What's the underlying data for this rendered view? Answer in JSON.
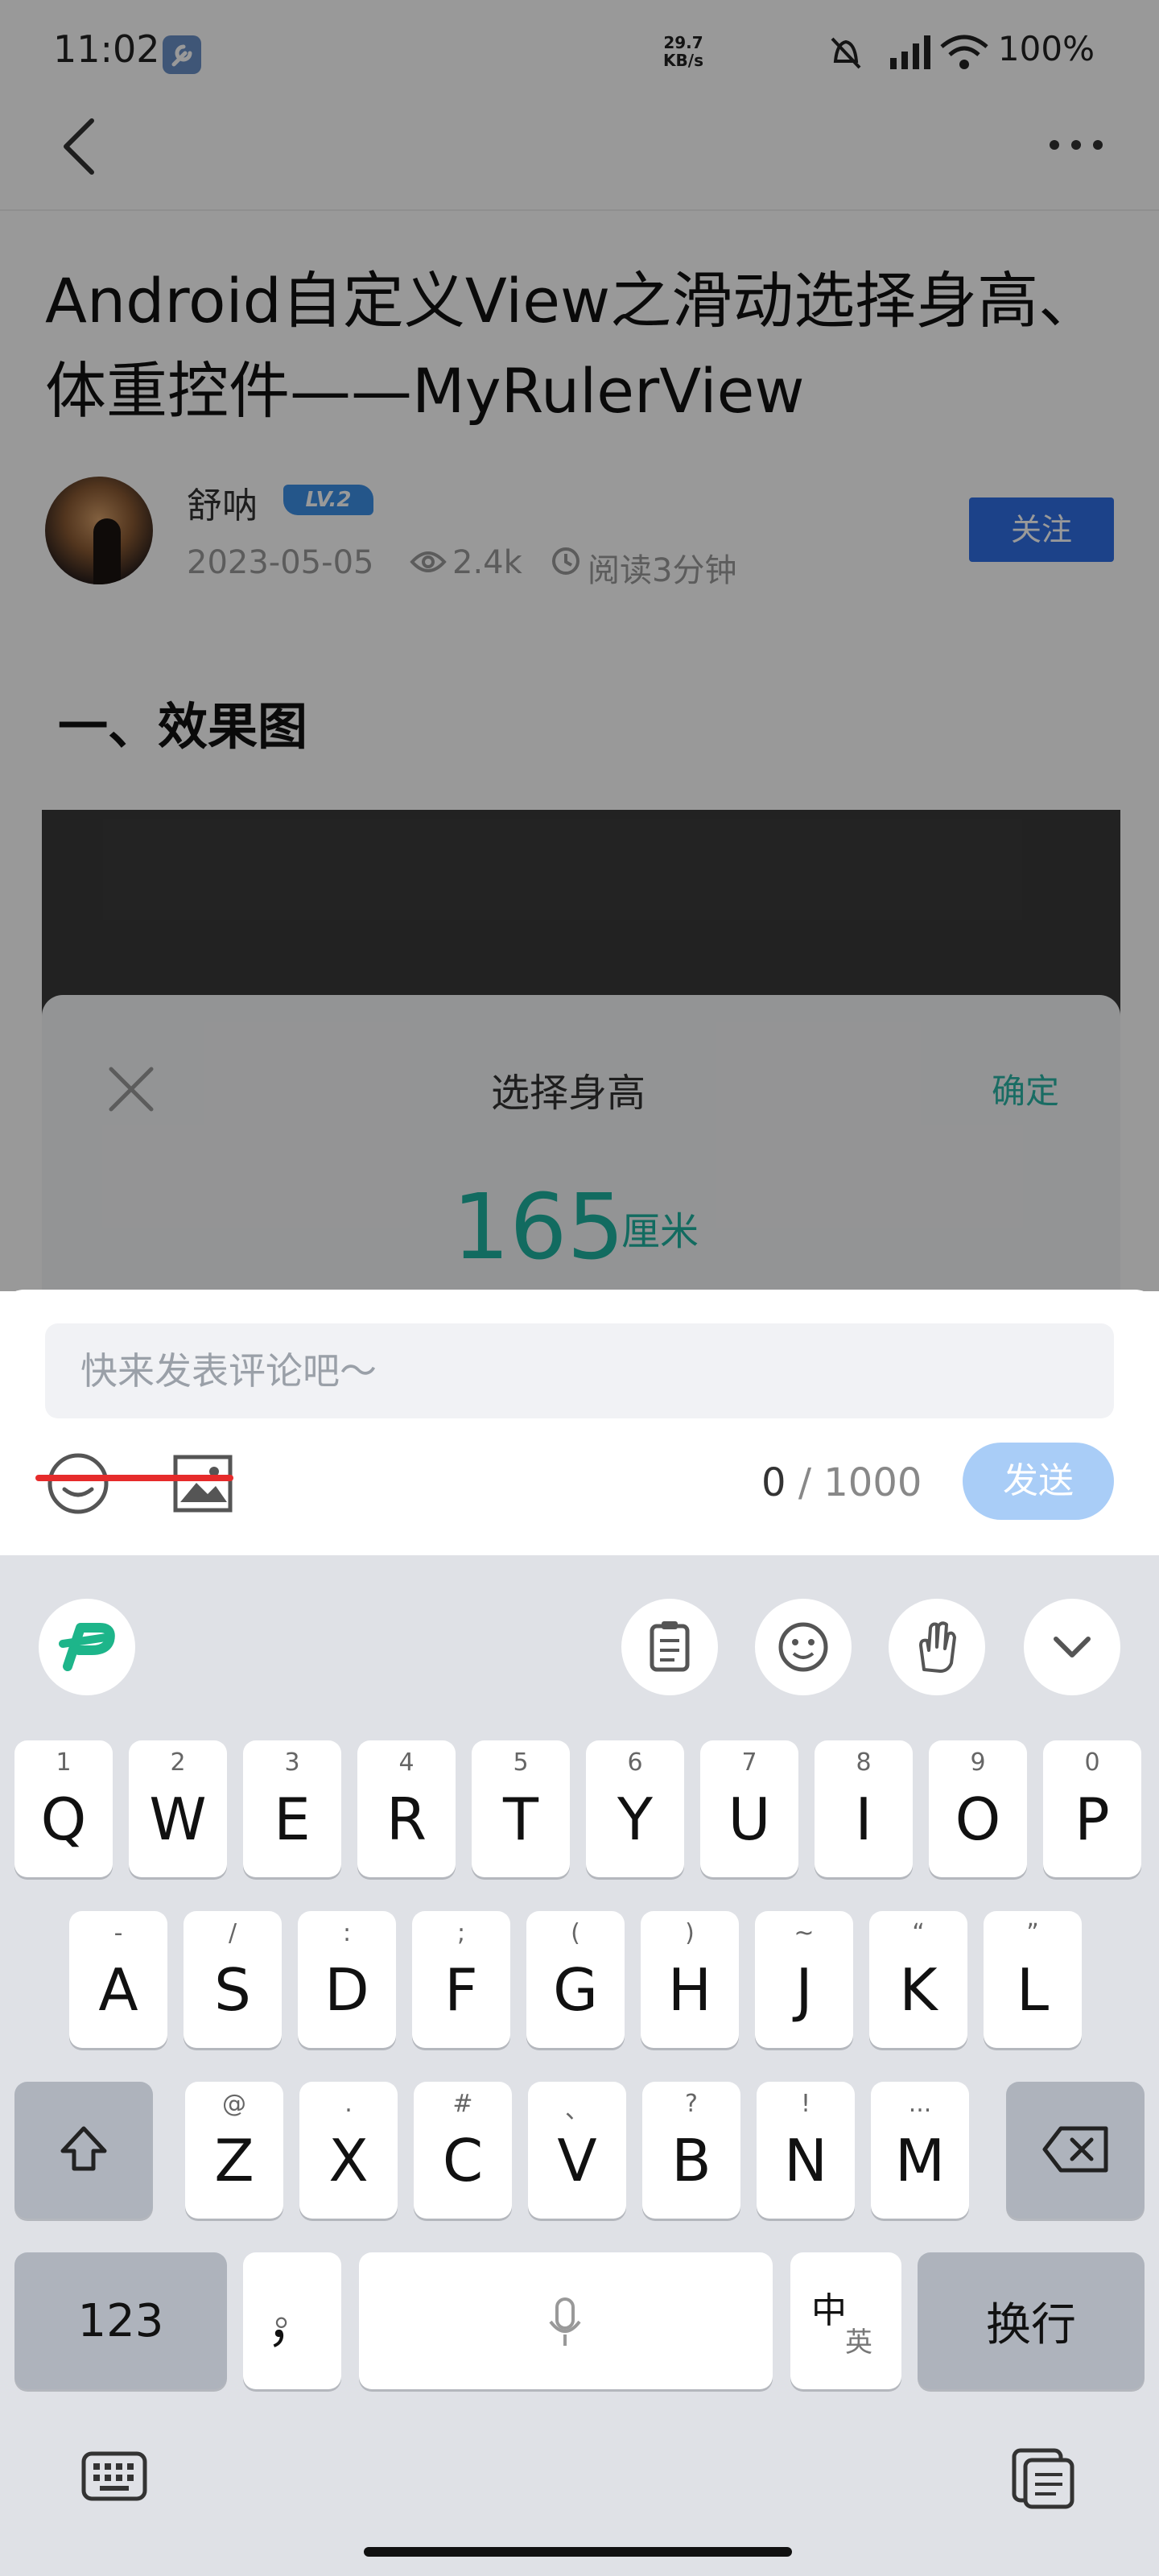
{
  "status_bar": {
    "time": "11:02",
    "speed_value": "29.7",
    "speed_unit": "KB/s",
    "battery": "100%"
  },
  "article": {
    "title": "Android自定义View之滑动选择身高、体重控件——MyRulerView",
    "author": "舒呐",
    "level": "LV.2",
    "date": "2023-05-05",
    "views": "2.4k",
    "read_time": "阅读3分钟",
    "follow_label": "关注",
    "section_heading": "一、效果图"
  },
  "picker": {
    "title": "选择身高",
    "confirm_label": "确定",
    "value": "165",
    "unit": "厘米"
  },
  "comment": {
    "placeholder": "快来发表评论吧～",
    "count": "0",
    "max": "/ 1000",
    "send_label": "发送"
  },
  "keyboard": {
    "row1": [
      {
        "main": "Q",
        "sub": "1"
      },
      {
        "main": "W",
        "sub": "2"
      },
      {
        "main": "E",
        "sub": "3"
      },
      {
        "main": "R",
        "sub": "4"
      },
      {
        "main": "T",
        "sub": "5"
      },
      {
        "main": "Y",
        "sub": "6"
      },
      {
        "main": "U",
        "sub": "7"
      },
      {
        "main": "I",
        "sub": "8"
      },
      {
        "main": "O",
        "sub": "9"
      },
      {
        "main": "P",
        "sub": "0"
      }
    ],
    "row2": [
      {
        "main": "A",
        "sub": "-"
      },
      {
        "main": "S",
        "sub": "/"
      },
      {
        "main": "D",
        "sub": ":"
      },
      {
        "main": "F",
        "sub": ";"
      },
      {
        "main": "G",
        "sub": "("
      },
      {
        "main": "H",
        "sub": ")"
      },
      {
        "main": "J",
        "sub": "~"
      },
      {
        "main": "K",
        "sub": "“"
      },
      {
        "main": "L",
        "sub": "”"
      }
    ],
    "row3": [
      {
        "main": "Z",
        "sub": "@"
      },
      {
        "main": "X",
        "sub": "."
      },
      {
        "main": "C",
        "sub": "#"
      },
      {
        "main": "V",
        "sub": "、"
      },
      {
        "main": "B",
        "sub": "?"
      },
      {
        "main": "N",
        "sub": "!"
      },
      {
        "main": "M",
        "sub": "..."
      }
    ],
    "numbers_label": "123",
    "comma_key": "，",
    "comma_sub": "。",
    "lang_main": "中",
    "lang_sub": "英",
    "enter_label": "换行"
  },
  "colors": {
    "accent_teal": "#1fb2a0",
    "follow_blue": "#2f6fe4",
    "send_disabled": "#a9cdf7",
    "keyboard_bg": "#dfe1e6"
  },
  "icons": [
    "wrench-icon",
    "back-icon",
    "more-icon",
    "eye-icon",
    "clock-icon",
    "close-icon",
    "emoji-icon",
    "image-icon",
    "clipboard-icon",
    "sticker-icon",
    "gesture-icon",
    "chevron-down-icon",
    "shift-icon",
    "backspace-icon",
    "mic-icon",
    "keyboard-icon",
    "clipboard-switch-icon"
  ]
}
